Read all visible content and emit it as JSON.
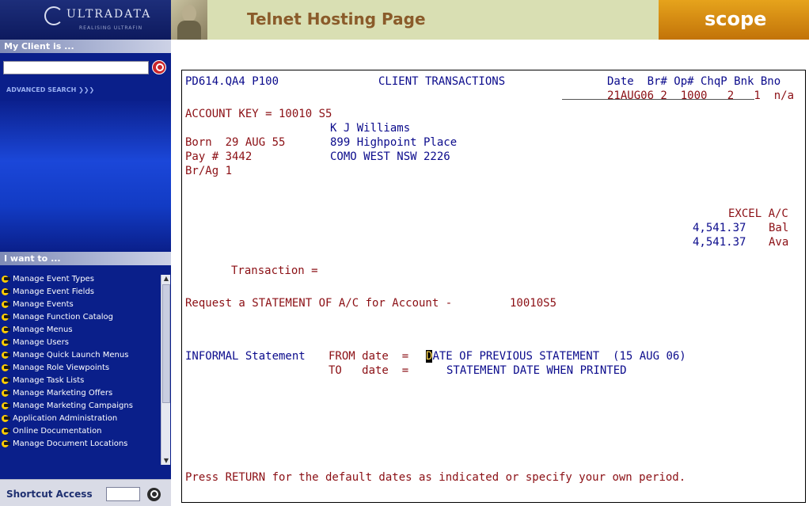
{
  "sidebar": {
    "logo_text": "ULTRADATA",
    "logo_tagline": "REALISING ULTRAFIN",
    "client_label": "My Client is ...",
    "search_placeholder": "",
    "advanced_search": "ADVANCED SEARCH",
    "iwant_label": "I want to ...",
    "menu_items": [
      "Manage Event Types",
      "Manage Event Fields",
      "Manage Events",
      "Manage Function Catalog",
      "Manage Menus",
      "Manage Users",
      "Manage Quick Launch Menus",
      "Manage Role Viewpoints",
      "Manage Task Lists",
      "Manage Marketing Offers",
      "Manage Marketing Campaigns",
      "Application Administration",
      "Online Documentation",
      "Manage Document Locations"
    ],
    "shortcut_label": "Shortcut Access"
  },
  "header": {
    "title": "Telnet Hosting Page",
    "brand": "scope"
  },
  "terminal": {
    "screen_id": "PD614.QA4 P100",
    "screen_title": "CLIENT TRANSACTIONS",
    "col_headers": "Date  Br# Op# ChqP Bnk Bno",
    "col_values": "21AUG06 2  1000   2   1  n/a",
    "account_key": "ACCOUNT KEY = 10010 S5",
    "client_name": "K J Williams",
    "born_label": "Born  29 AUG 55",
    "address1": "899 Highpoint Place",
    "pay_label": "Pay # 3442",
    "address2": "COMO WEST NSW 2226",
    "brag": "Br/Ag 1",
    "account_type": "EXCEL A/C",
    "bal_amount": "4,541.37",
    "bal_label": "Bal",
    "ava_amount": "4,541.37",
    "ava_label": "Ava",
    "transaction_label": "Transaction =",
    "request_text": "Request a STATEMENT OF A/C for Account -",
    "request_account": "10010S5",
    "informal_label": "INFORMAL Statement",
    "from_label": "FROM date  =",
    "from_cursor_char": "D",
    "from_value": "ATE OF PREVIOUS STATEMENT  (15 AUG 06)",
    "to_label": "TO   date  =",
    "to_value": "STATEMENT DATE WHEN PRINTED",
    "footer_prompt": "Press RETURN for the default dates as indicated or specify your own period."
  }
}
